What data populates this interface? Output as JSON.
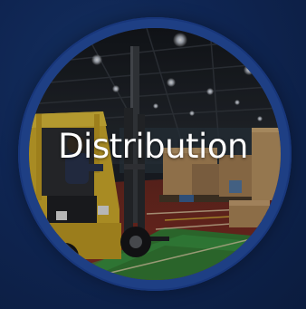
{
  "tile": {
    "label": "Distribution",
    "image_subject": "warehouse-forklift-photo",
    "colors": {
      "background": "#0d2146",
      "ring": "#1e3f84",
      "label": "#ffffff"
    }
  }
}
